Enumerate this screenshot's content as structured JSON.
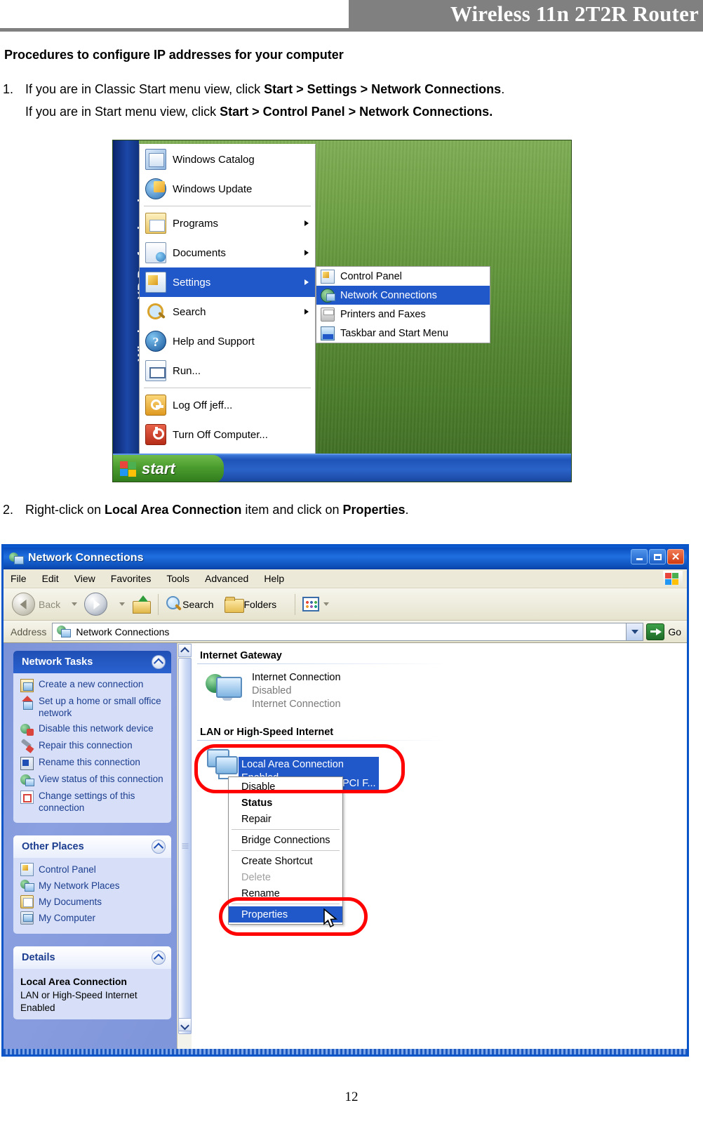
{
  "header": {
    "product_title": "Wireless 11n 2T2R Router"
  },
  "document": {
    "section_title": "Procedures to configure IP addresses for your computer",
    "page_number": "12",
    "steps": [
      {
        "number": "1.",
        "line1_pre": "If you are in Classic Start menu view, click ",
        "line1_bold": "Start > Settings > Network Connections",
        "line1_post": ".",
        "line2_pre": "If you are in Start menu view, click ",
        "line2_bold": "Start > Control Panel > Network Connections."
      },
      {
        "number": "2.",
        "pre": "Right-click on ",
        "bold1": "Local Area Connection",
        "mid": " item and click on ",
        "bold2": "Properties",
        "post": "."
      }
    ]
  },
  "start_menu": {
    "os_strip_label": "Windows XP Professional",
    "items": [
      {
        "label": "Windows Catalog",
        "icon": "windows-catalog-icon",
        "arrow": false,
        "selected": false
      },
      {
        "label": "Windows Update",
        "icon": "windows-update-icon",
        "arrow": false,
        "selected": false
      },
      {
        "label": "Programs",
        "icon": "programs-icon",
        "arrow": true,
        "selected": false
      },
      {
        "label": "Documents",
        "icon": "documents-icon",
        "arrow": true,
        "selected": false
      },
      {
        "label": "Settings",
        "icon": "settings-icon",
        "arrow": true,
        "selected": true
      },
      {
        "label": "Search",
        "icon": "search-icon",
        "arrow": true,
        "selected": false
      },
      {
        "label": "Help and Support",
        "icon": "help-icon",
        "arrow": false,
        "selected": false
      },
      {
        "label": "Run...",
        "icon": "run-icon",
        "arrow": false,
        "selected": false
      },
      {
        "label": "Log Off jeff...",
        "icon": "logoff-icon",
        "arrow": false,
        "selected": false
      },
      {
        "label": "Turn Off Computer...",
        "icon": "turnoff-icon",
        "arrow": false,
        "selected": false
      }
    ],
    "submenu": [
      {
        "label": "Control Panel",
        "icon": "control-panel-icon",
        "selected": false
      },
      {
        "label": "Network Connections",
        "icon": "network-connections-icon",
        "selected": true
      },
      {
        "label": "Printers and Faxes",
        "icon": "printers-faxes-icon",
        "selected": false
      },
      {
        "label": "Taskbar and Start Menu",
        "icon": "taskbar-startmenu-icon",
        "selected": false
      }
    ],
    "taskbar": {
      "start_label": "start"
    }
  },
  "nc_window": {
    "title": "Network Connections",
    "window_buttons": {
      "minimize": "minimize",
      "maximize": "maximize",
      "close": "close"
    },
    "menus": [
      "File",
      "Edit",
      "View",
      "Favorites",
      "Tools",
      "Advanced",
      "Help"
    ],
    "toolbar": {
      "back_label": "Back",
      "search_label": "Search",
      "folders_label": "Folders"
    },
    "address": {
      "label": "Address",
      "value": "Network Connections",
      "go_label": "Go"
    },
    "sidebar": {
      "network_tasks": {
        "title": "Network Tasks",
        "items": [
          {
            "label": "Create a new connection",
            "icon": "new-connection-icon"
          },
          {
            "label": "Set up a home or small office network",
            "icon": "home-network-icon"
          },
          {
            "label": "Disable this network device",
            "icon": "disable-device-icon"
          },
          {
            "label": "Repair this connection",
            "icon": "repair-icon"
          },
          {
            "label": "Rename this connection",
            "icon": "rename-icon"
          },
          {
            "label": "View status of this connection",
            "icon": "view-status-icon"
          },
          {
            "label": "Change settings of this connection",
            "icon": "change-settings-icon"
          }
        ]
      },
      "other_places": {
        "title": "Other Places",
        "items": [
          {
            "label": "Control Panel",
            "icon": "control-panel-icon"
          },
          {
            "label": "My Network Places",
            "icon": "my-network-places-icon"
          },
          {
            "label": "My Documents",
            "icon": "my-documents-icon"
          },
          {
            "label": "My Computer",
            "icon": "my-computer-icon"
          }
        ]
      },
      "details": {
        "title": "Details",
        "name": "Local Area Connection",
        "type": "LAN or High-Speed Internet",
        "state": "Enabled"
      }
    },
    "content": {
      "group1_title": "Internet Gateway",
      "gateway_item": {
        "name": "Internet Connection",
        "status": "Disabled",
        "device": "Internet Connection"
      },
      "group2_title": "LAN or High-Speed Internet",
      "lan_item": {
        "name": "Local Area Connection",
        "status": "Enabled",
        "device": "PCI F..."
      }
    },
    "context_menu": [
      {
        "label": "Disable",
        "style": "normal",
        "separator_after": false
      },
      {
        "label": "Status",
        "style": "bold",
        "separator_after": false
      },
      {
        "label": "Repair",
        "style": "normal",
        "separator_after": true
      },
      {
        "label": "Bridge Connections",
        "style": "normal",
        "separator_after": true
      },
      {
        "label": "Create Shortcut",
        "style": "normal",
        "separator_after": false
      },
      {
        "label": "Delete",
        "style": "disabled",
        "separator_after": false
      },
      {
        "label": "Rename",
        "style": "normal",
        "separator_after": true
      },
      {
        "label": "Properties",
        "style": "selected",
        "separator_after": false
      }
    ]
  },
  "annotations": {
    "highlight_color": "#ff0000",
    "highlight_targets": [
      "local-area-connection-item",
      "properties-menu-item"
    ]
  }
}
